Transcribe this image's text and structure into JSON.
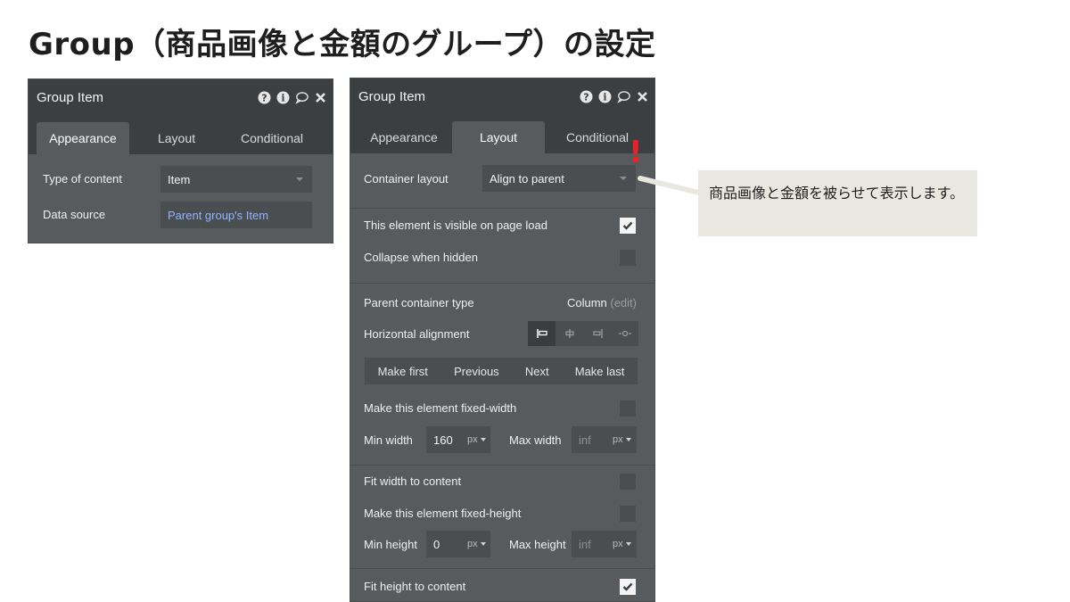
{
  "page": {
    "title": "Group（商品画像と金額のグループ）の設定"
  },
  "left_panel": {
    "title": "Group Item",
    "tabs": [
      "Appearance",
      "Layout",
      "Conditional"
    ],
    "active_tab": "Appearance",
    "fields": {
      "type_of_content_label": "Type of content",
      "type_of_content_value": "Item",
      "data_source_label": "Data source",
      "data_source_value": "Parent group's Item"
    }
  },
  "right_panel": {
    "title": "Group Item",
    "tabs": [
      "Appearance",
      "Layout",
      "Conditional"
    ],
    "active_tab": "Layout",
    "container_layout_label": "Container layout",
    "container_layout_value": "Align to parent",
    "warning_marker": "!",
    "visible_on_load_label": "This element is visible on page load",
    "visible_on_load_checked": true,
    "collapse_when_hidden_label": "Collapse when hidden",
    "collapse_when_hidden_checked": false,
    "parent_container_type_label": "Parent container type",
    "parent_container_type_value": "Column",
    "parent_container_type_edit": "(edit)",
    "horizontal_alignment_label": "Horizontal alignment",
    "horizontal_alignment_options": [
      "left",
      "center",
      "right",
      "stretch"
    ],
    "horizontal_alignment_selected": "left",
    "order_buttons": [
      "Make first",
      "Previous",
      "Next",
      "Make last"
    ],
    "fixed_width_label": "Make this element fixed-width",
    "fixed_width_checked": false,
    "min_width_label": "Min width",
    "min_width_value": "160",
    "min_width_unit": "px",
    "max_width_label": "Max width",
    "max_width_placeholder": "inf",
    "max_width_unit": "px",
    "fit_width_label": "Fit width to content",
    "fit_width_checked": false,
    "fixed_height_label": "Make this element fixed-height",
    "fixed_height_checked": false,
    "min_height_label": "Min height",
    "min_height_value": "0",
    "min_height_unit": "px",
    "max_height_label": "Max height",
    "max_height_placeholder": "inf",
    "max_height_unit": "px",
    "fit_height_label": "Fit height to content",
    "fit_height_checked": true
  },
  "callout": {
    "text": "商品画像と金額を被らせて表示します。"
  },
  "colors": {
    "panel_bg": "#585b5e",
    "header_bg": "#3c3f42",
    "field_bg": "#4b4e51",
    "warning_red": "#e8212b",
    "link_blue": "#8fb6ff",
    "callout_bg": "#e8e7e0"
  },
  "icons": [
    "help-icon",
    "info-icon",
    "comment-icon",
    "close-icon",
    "checkmark-icon",
    "caret-down-icon"
  ]
}
